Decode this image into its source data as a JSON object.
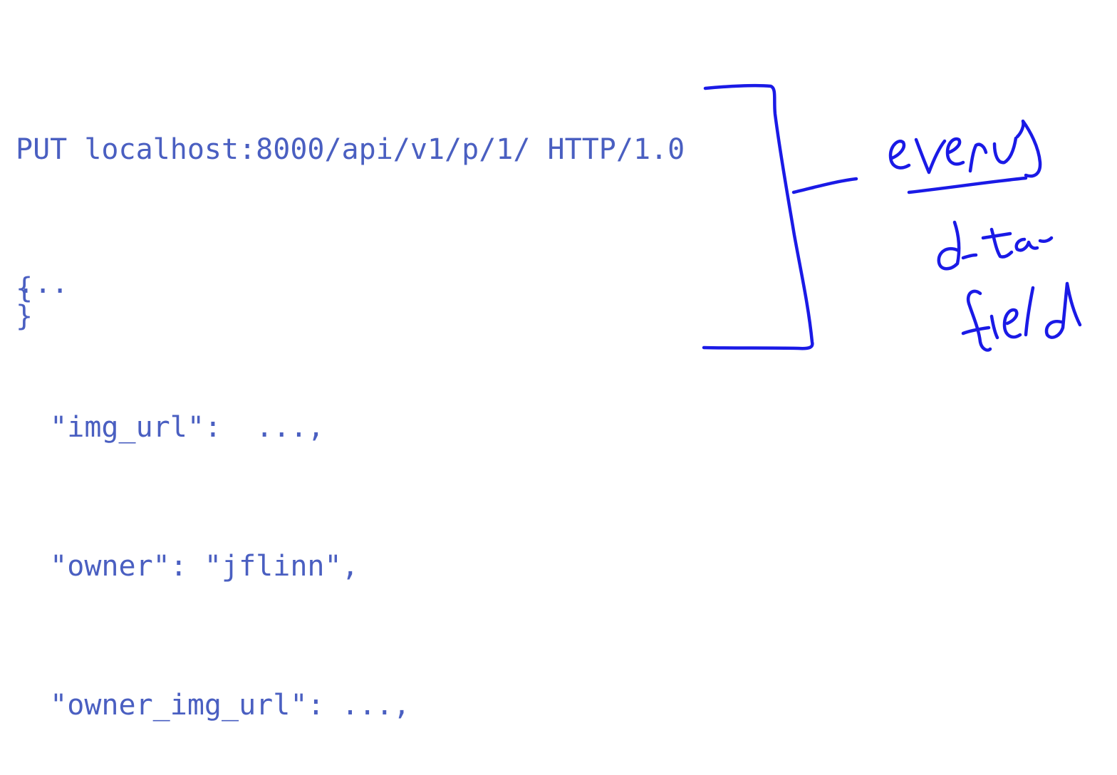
{
  "request": {
    "line": "PUT localhost:8000/api/v1/p/1/ HTTP/1.0",
    "open_brace": "{",
    "fields": [
      "  \"img_url\":  ...,",
      "  \"owner\": \"jflinn\",",
      "  \"owner_img_url\": ...,"
    ],
    "ellipsis": "...",
    "close_brace": "}"
  },
  "annotation": {
    "color": "#1a1ae6",
    "words": [
      "every",
      "data",
      "field"
    ]
  },
  "colors": {
    "code_text": "#4a5fc1",
    "background": "#ffffff"
  }
}
